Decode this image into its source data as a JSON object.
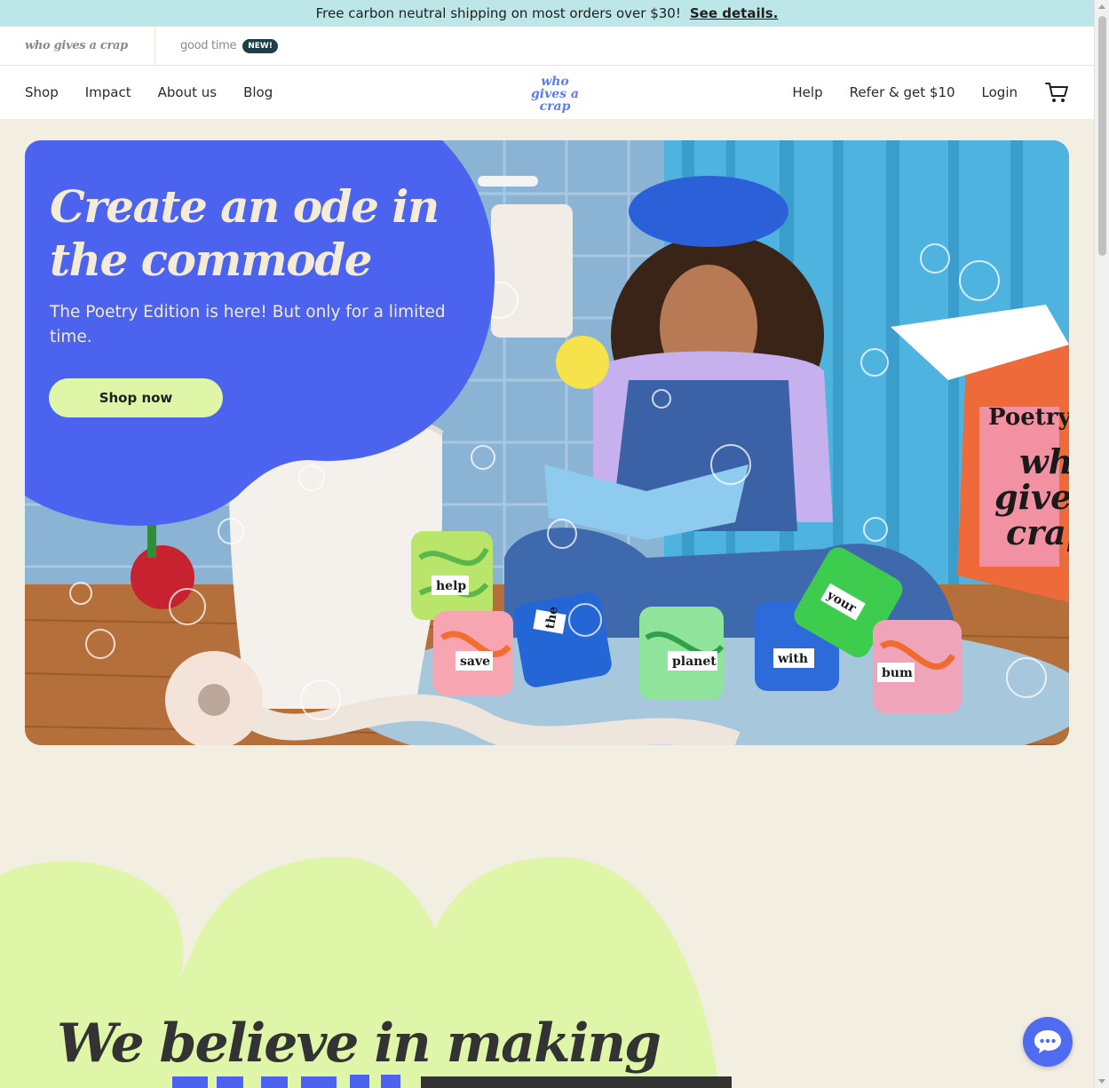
{
  "promo": {
    "text": "Free carbon neutral shipping on most orders over $30!",
    "link": "See details."
  },
  "brands": {
    "primary": "who gives a crap",
    "secondary": "good time",
    "badge": "NEW!"
  },
  "nav": {
    "left": [
      "Shop",
      "Impact",
      "About us",
      "Blog"
    ],
    "logo": [
      "who",
      "gives a",
      "crap"
    ],
    "right": [
      "Help",
      "Refer & get $10",
      "Login"
    ]
  },
  "hero": {
    "title": "Create an ode in the commode",
    "subtitle": "The Poetry Edition is here! But only for a limited time.",
    "cta": "Shop now",
    "rolls": [
      "help",
      "save",
      "the",
      "planet",
      "with",
      "your",
      "bum"
    ],
    "box": [
      "Poetry",
      "who",
      "gives a",
      "crap"
    ]
  },
  "believe": {
    "title": "We believe in making"
  },
  "colors": {
    "accent": "#4f6bf0",
    "promo": "#bde6e9",
    "cta": "#dff6a8",
    "cream": "#f2eee2",
    "green": "#dff6a8"
  }
}
